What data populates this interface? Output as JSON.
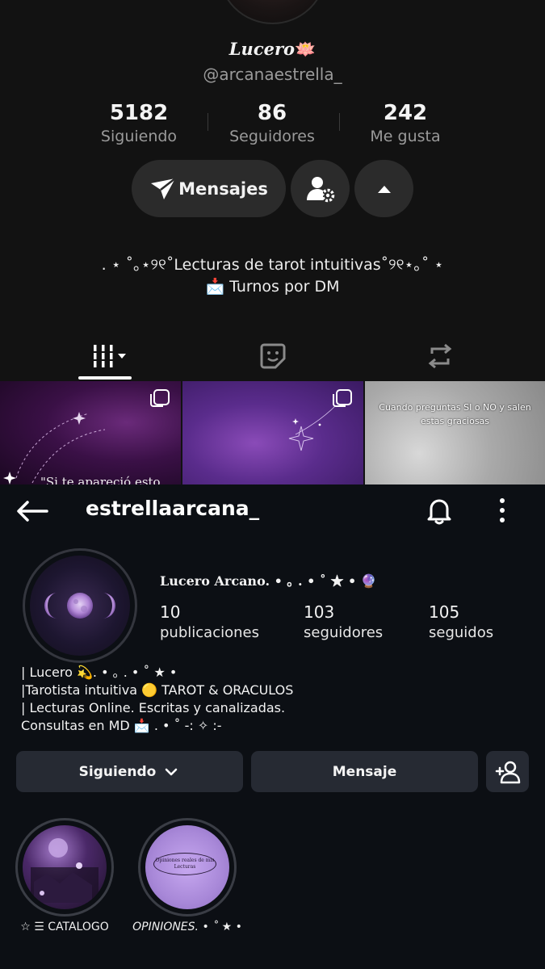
{
  "tiktok": {
    "display_name": "Lucero",
    "display_name_emoji": "🪷",
    "handle": "@arcanaestrella_",
    "stats": [
      {
        "value": "5182",
        "label": "Siguiendo"
      },
      {
        "value": "86",
        "label": "Seguidores"
      },
      {
        "value": "242",
        "label": "Me gusta"
      }
    ],
    "message_button": "Mensajes",
    "bio_line1": ". ⋆ ˚｡⋆୨୧˚Lecturas de tarot intuitivas˚୨୧⋆｡˚ ⋆",
    "bio_line2": "📩 Turnos por DM",
    "tiles": [
      {
        "caption": "\"Si te apareció esto"
      },
      {
        "caption": ""
      },
      {
        "caption": "Cuando preguntas SI o NO y salen estas graciosas"
      }
    ]
  },
  "instagram": {
    "username": "estrellaarcana_",
    "display_name": "Lucero Arcano. • ｡ . • ˚ ★ • 🔮",
    "stats": [
      {
        "value": "10",
        "label": "publicaciones"
      },
      {
        "value": "103",
        "label": "seguidores"
      },
      {
        "value": "105",
        "label": "seguidos"
      }
    ],
    "bio": [
      "| Lucero 💫. • ｡ . • ˚ ★ •",
      "|Tarotista intuitiva 🟡 TAROT & ORACULOS",
      "| Lecturas Online. Escritas y canalizadas.",
      "Consultas en MD 📩 . • ˚ -: ✧ :-"
    ],
    "following_button": "Siguiendo",
    "message_button": "Mensaje",
    "highlights": [
      {
        "label": "☆ ☰ CATALOGO"
      },
      {
        "label": "OPINIONES. • ˚ ★ •",
        "cover_text": "Opiniones reales de mis Lecturas"
      }
    ]
  }
}
